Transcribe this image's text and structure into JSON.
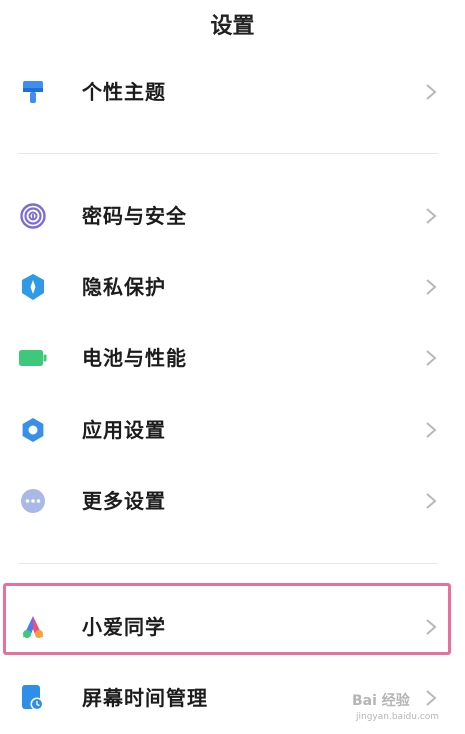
{
  "header": {
    "title": "设置"
  },
  "items": [
    {
      "key": "theme",
      "label": "个性主题",
      "icon": "paint-brush-icon",
      "color": "#3f8ff0"
    },
    {
      "key": "password",
      "label": "密码与安全",
      "icon": "fingerprint-icon",
      "color": "#7a6cd9"
    },
    {
      "key": "privacy",
      "label": "隐私保护",
      "icon": "shield-icon",
      "color": "#2f9ae8"
    },
    {
      "key": "battery",
      "label": "电池与性能",
      "icon": "battery-icon",
      "color": "#3ec97a"
    },
    {
      "key": "apps",
      "label": "应用设置",
      "icon": "gear-icon",
      "color": "#3a8fe8"
    },
    {
      "key": "more",
      "label": "更多设置",
      "icon": "more-dots-icon",
      "color": "#a9b8e6"
    },
    {
      "key": "xiaoai",
      "label": "小爱同学",
      "icon": "xiaoai-logo-icon",
      "color": "#4b7bf5"
    },
    {
      "key": "screentime",
      "label": "屏幕时间管理",
      "icon": "screen-time-icon",
      "color": "#2f8fe8"
    }
  ],
  "highlight": {
    "color": "#e9709c"
  },
  "watermark": {
    "brand": "Bai 经验",
    "sub": "jingyan.baidu.com"
  }
}
